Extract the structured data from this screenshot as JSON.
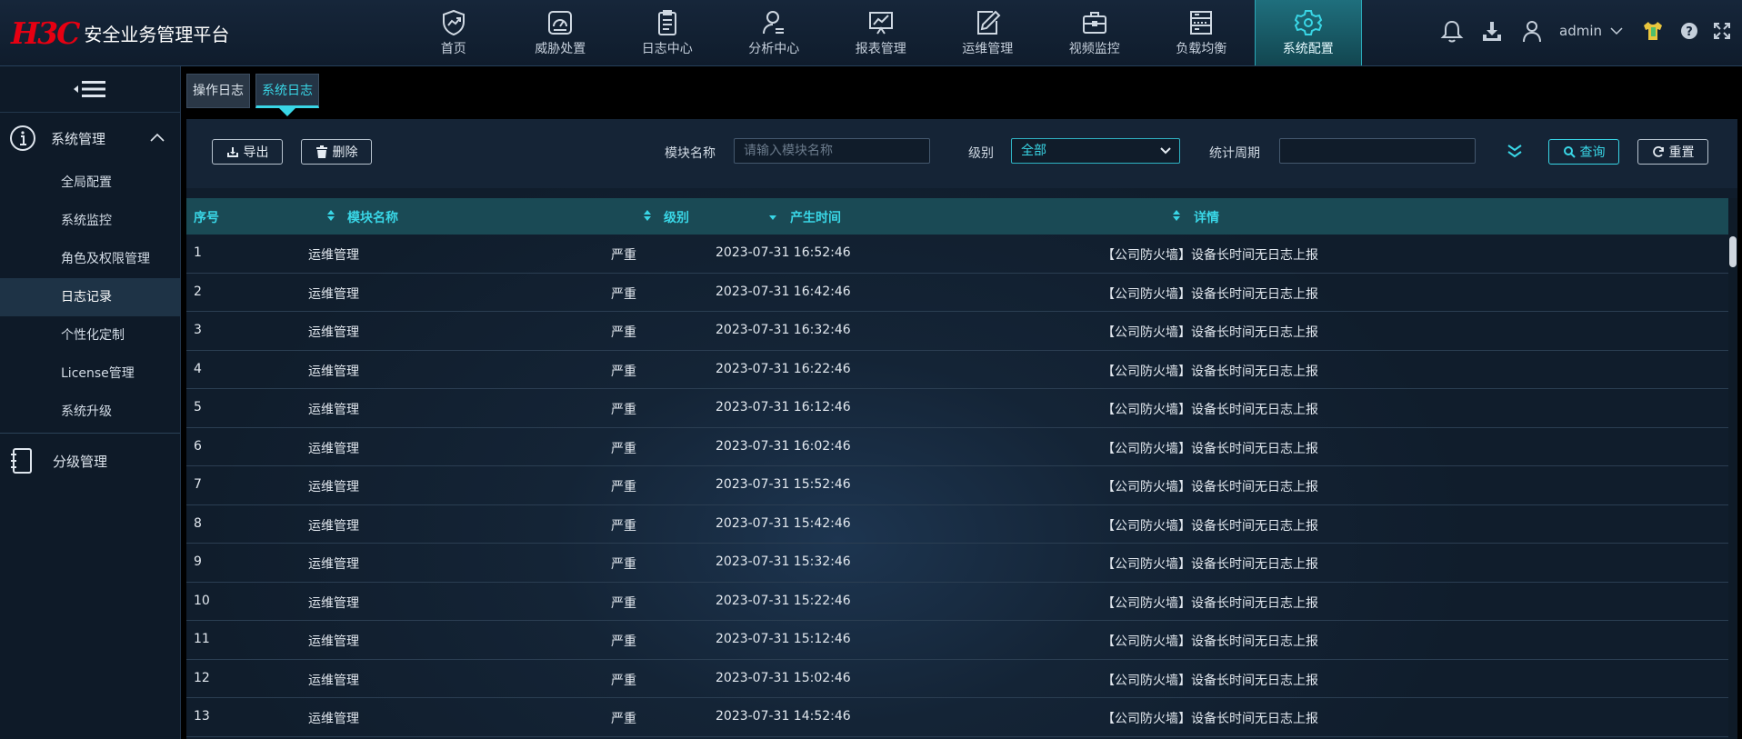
{
  "app": {
    "logo_mark": "H3C",
    "title": "安全业务管理平台"
  },
  "nav": [
    {
      "label": "首页",
      "icon": "home-shield-icon"
    },
    {
      "label": "威胁处置",
      "icon": "threat-gauge-icon"
    },
    {
      "label": "日志中心",
      "icon": "clipboard-icon"
    },
    {
      "label": "分析中心",
      "icon": "user-analysis-icon"
    },
    {
      "label": "报表管理",
      "icon": "chart-board-icon"
    },
    {
      "label": "运维管理",
      "icon": "edit-pen-icon"
    },
    {
      "label": "视频监控",
      "icon": "briefcase-icon"
    },
    {
      "label": "负载均衡",
      "icon": "server-rack-icon"
    },
    {
      "label": "系统配置",
      "icon": "gear-config-icon",
      "active": true
    }
  ],
  "header_right": {
    "username": "admin",
    "icons": [
      "bell-icon",
      "download-icon",
      "user-icon",
      "chevron-down-icon",
      "theme-shirt-icon",
      "help-icon",
      "fullscreen-icon"
    ]
  },
  "sidebar": {
    "collapse_icon": "menu-collapse-icon",
    "group1": {
      "label": "系统管理",
      "icon": "info-circle-icon",
      "items": [
        "全局配置",
        "系统监控",
        "角色及权限管理",
        "日志记录",
        "个性化定制",
        "License管理",
        "系统升级"
      ],
      "active_index": 3
    },
    "group2": {
      "label": "分级管理",
      "icon": "notebook-icon"
    }
  },
  "tabs": [
    {
      "label": "操作日志"
    },
    {
      "label": "系统日志",
      "active": true
    }
  ],
  "toolbar": {
    "export_label": "导出",
    "delete_label": "删除",
    "module_label": "模块名称",
    "module_placeholder": "请输入模块名称",
    "level_label": "级别",
    "level_value": "全部",
    "period_label": "统计周期",
    "period_value": "",
    "query_label": "查询",
    "reset_label": "重置"
  },
  "table": {
    "columns": [
      "序号",
      "模块名称",
      "级别",
      "产生时间",
      "详情"
    ],
    "rows": [
      [
        "1",
        "运维管理",
        "严重",
        "2023-07-31 16:52:46",
        "【公司防火墙】设备长时间无日志上报"
      ],
      [
        "2",
        "运维管理",
        "严重",
        "2023-07-31 16:42:46",
        "【公司防火墙】设备长时间无日志上报"
      ],
      [
        "3",
        "运维管理",
        "严重",
        "2023-07-31 16:32:46",
        "【公司防火墙】设备长时间无日志上报"
      ],
      [
        "4",
        "运维管理",
        "严重",
        "2023-07-31 16:22:46",
        "【公司防火墙】设备长时间无日志上报"
      ],
      [
        "5",
        "运维管理",
        "严重",
        "2023-07-31 16:12:46",
        "【公司防火墙】设备长时间无日志上报"
      ],
      [
        "6",
        "运维管理",
        "严重",
        "2023-07-31 16:02:46",
        "【公司防火墙】设备长时间无日志上报"
      ],
      [
        "7",
        "运维管理",
        "严重",
        "2023-07-31 15:52:46",
        "【公司防火墙】设备长时间无日志上报"
      ],
      [
        "8",
        "运维管理",
        "严重",
        "2023-07-31 15:42:46",
        "【公司防火墙】设备长时间无日志上报"
      ],
      [
        "9",
        "运维管理",
        "严重",
        "2023-07-31 15:32:46",
        "【公司防火墙】设备长时间无日志上报"
      ],
      [
        "10",
        "运维管理",
        "严重",
        "2023-07-31 15:22:46",
        "【公司防火墙】设备长时间无日志上报"
      ],
      [
        "11",
        "运维管理",
        "严重",
        "2023-07-31 15:12:46",
        "【公司防火墙】设备长时间无日志上报"
      ],
      [
        "12",
        "运维管理",
        "严重",
        "2023-07-31 15:02:46",
        "【公司防火墙】设备长时间无日志上报"
      ],
      [
        "13",
        "运维管理",
        "严重",
        "2023-07-31 14:52:46",
        "【公司防火墙】设备长时间无日志上报"
      ]
    ]
  },
  "colors": {
    "accent": "#39d6e6",
    "brand_red": "#e60012",
    "header_bg": "#16263a",
    "table_head_bg": "#1a4a55"
  }
}
